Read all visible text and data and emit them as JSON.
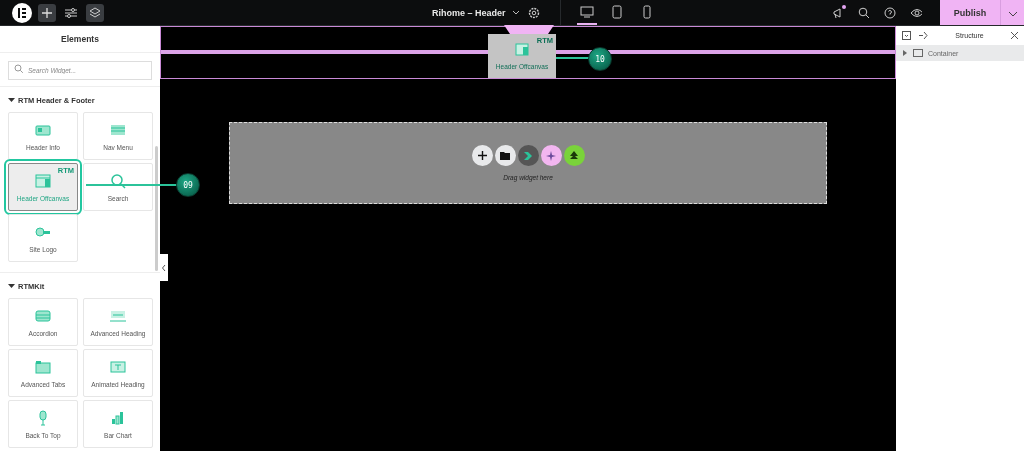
{
  "topbar": {
    "title": "Rihome – Header",
    "devices": [
      {
        "kind": "desktop",
        "selected": true
      },
      {
        "kind": "tablet",
        "selected": false
      },
      {
        "kind": "mobile",
        "selected": false
      }
    ],
    "notification": true,
    "publish": "Publish"
  },
  "panel": {
    "title": "Elements",
    "search": {
      "placeholder": "Search Widget..."
    },
    "categories": [
      {
        "name": "RTM Header & Footer",
        "expanded": true,
        "widgets": [
          {
            "label": "Header Info",
            "kind": "info",
            "selected": false
          },
          {
            "label": "Nav Menu",
            "kind": "menu",
            "selected": false
          },
          {
            "label": "Header Offcanvas",
            "kind": "offcanvas",
            "selected": true,
            "badge": "RTM"
          },
          {
            "label": "Search",
            "kind": "search",
            "selected": false
          },
          {
            "label": "Site Logo",
            "kind": "logo",
            "selected": false
          }
        ]
      },
      {
        "name": "RTMKit",
        "expanded": true,
        "widgets": [
          {
            "label": "Accordion",
            "kind": "accordion",
            "selected": false
          },
          {
            "label": "Advanced Heading",
            "kind": "heading",
            "selected": false
          },
          {
            "label": "Advanced Tabs",
            "kind": "tabs",
            "selected": false
          },
          {
            "label": "Animated Heading",
            "kind": "animated",
            "selected": false
          },
          {
            "label": "Back To Top",
            "kind": "top",
            "selected": false
          },
          {
            "label": "Bar Chart",
            "kind": "bar",
            "selected": false
          }
        ]
      }
    ]
  },
  "canvas": {
    "dragged": {
      "label": "Header Offcanvas",
      "badge": "RTM"
    },
    "callouts": [
      "09",
      "10"
    ],
    "dropzone": "Drag widget here"
  },
  "structure": {
    "title": "Structure",
    "items": [
      {
        "label": "Container",
        "expanded": false
      }
    ]
  }
}
